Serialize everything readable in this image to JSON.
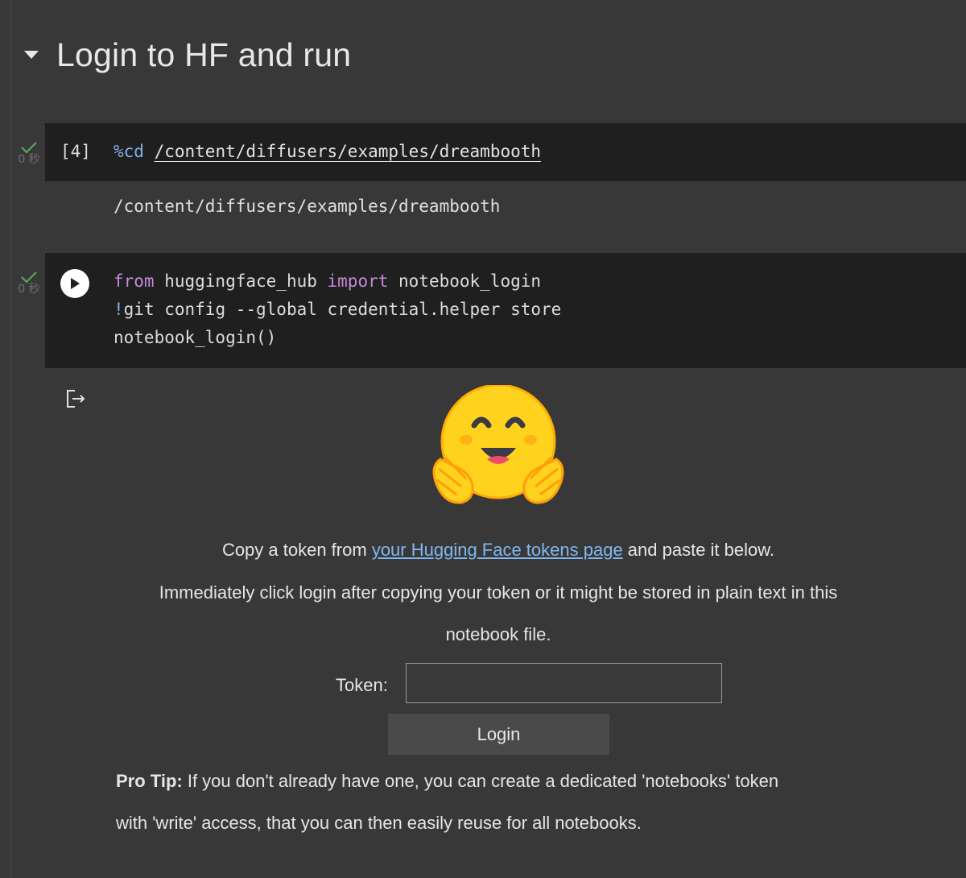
{
  "section": {
    "title": "Login to HF and run"
  },
  "cells": [
    {
      "exec_time": "0 秒",
      "exec_count": "[4]",
      "code": {
        "magic": "%cd",
        "path": "/content/diffusers/examples/dreambooth"
      },
      "output": "/content/diffusers/examples/dreambooth"
    },
    {
      "exec_time": "0 秒",
      "code_lines": [
        {
          "kw1": "from",
          "t1": " huggingface_hub ",
          "kw2": "import",
          "t2": " notebook_login"
        },
        {
          "bang": "!",
          "rest": "git config --global credential.helper store"
        },
        {
          "text": "notebook_login()"
        }
      ]
    }
  ],
  "login_widget": {
    "line1_before": "Copy a token from ",
    "line1_link": "your Hugging Face tokens page",
    "line1_after": " and paste it below.",
    "line2": "Immediately click login after copying your token or it might be stored in plain text in this",
    "line3": "notebook file.",
    "token_label": "Token:",
    "token_value": "",
    "login_button": "Login",
    "protip_bold": "Pro Tip:",
    "protip_line1": " If you don't already have one, you can create a dedicated 'notebooks' token",
    "protip_line2": "with 'write' access, that you can then easily reuse for all notebooks."
  },
  "icons": {
    "collapse": "triangle-down-icon",
    "status": "check-icon",
    "run": "play-icon",
    "output": "output-action-icon",
    "logo": "hugging-face-logo"
  },
  "colors": {
    "background": "#383838",
    "code_background": "#1f1f1f",
    "keyword": "#c589d6",
    "magic": "#80b2ec",
    "link": "#80b8ee",
    "check": "#5aa55a"
  }
}
